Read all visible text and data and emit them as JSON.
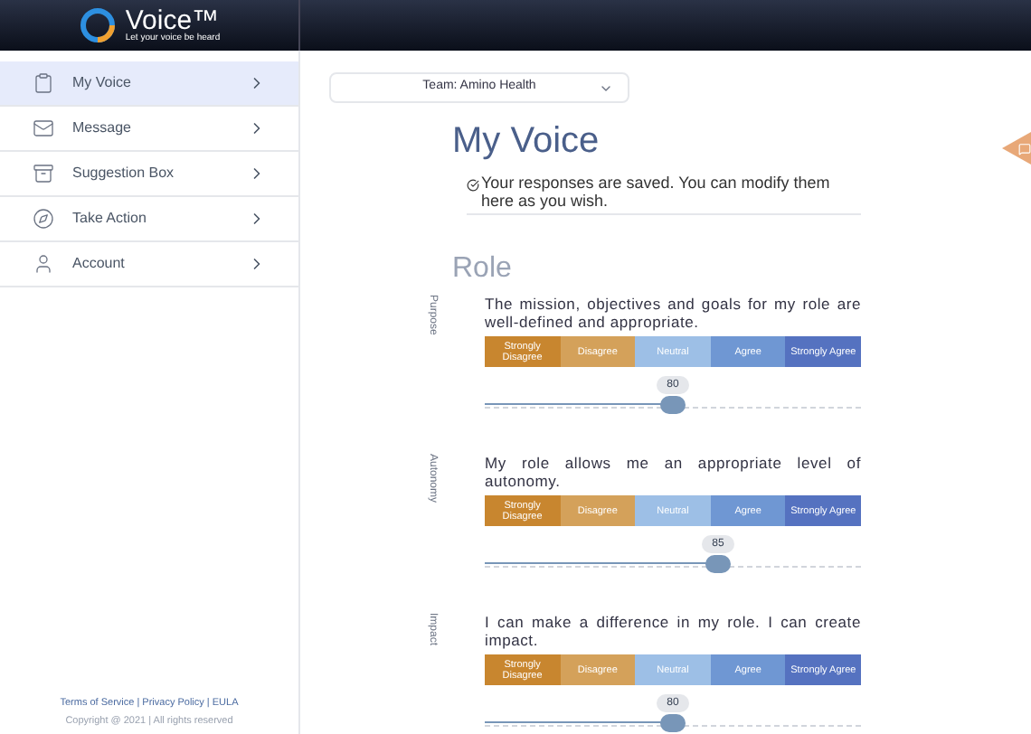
{
  "header": {
    "brand": "Voice™",
    "tagline": "Let your voice be heard"
  },
  "sidebar": {
    "items": [
      {
        "label": "My Voice",
        "selected": true
      },
      {
        "label": "Message",
        "selected": false
      },
      {
        "label": "Suggestion Box",
        "selected": false
      },
      {
        "label": "Take Action",
        "selected": false
      },
      {
        "label": "Account",
        "selected": false
      }
    ],
    "footer_links": [
      "Terms of Service | Privacy Policy | EULA"
    ],
    "copyright": "Copyright @ 2021 | All rights reserved"
  },
  "team_select": {
    "value": "Team: Amino Health"
  },
  "page_title": "My Voice",
  "saved_notice": "Your responses are saved. You can modify them here as you wish.",
  "section_title": "Role",
  "questions": [
    {
      "category": "Purpose",
      "text": "The mission, objectives and goals for my role are well-defined and appropriate.",
      "options": [
        "Strongly Disagree",
        "Disagree",
        "Neutral",
        "Agree",
        "Strongly Agree"
      ],
      "value": "80",
      "level": 0.5
    },
    {
      "category": "Autonomy",
      "text": "My role allows me an appropriate level of autonomy.",
      "options": [
        "Strongly Disagree",
        "Disagree",
        "Neutral",
        "Agree",
        "Strongly Agree"
      ],
      "value": "85",
      "level": 0.62
    },
    {
      "category": "Impact",
      "text": "I can make a difference in my role. I can create impact.",
      "options": [
        "Strongly Disagree",
        "Disagree",
        "Neutral",
        "Agree",
        "Strongly Agree"
      ],
      "value": "80",
      "level": 0.5
    }
  ]
}
